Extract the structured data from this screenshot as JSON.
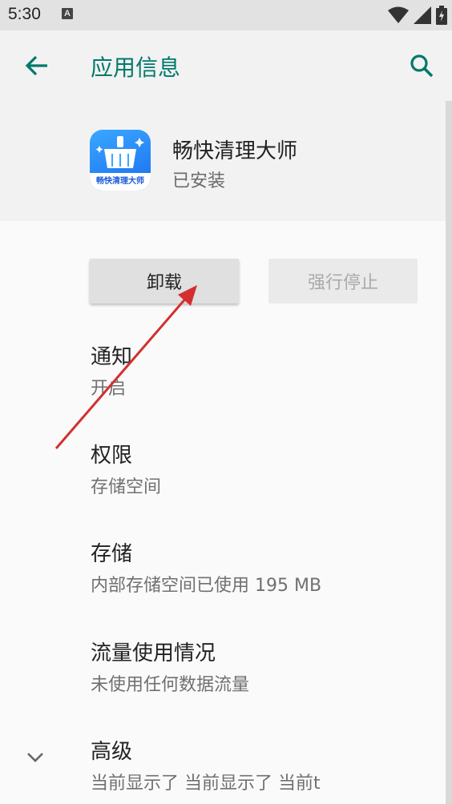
{
  "status_bar": {
    "time": "5:30",
    "notification_icon": "A"
  },
  "app_bar": {
    "title": "应用信息",
    "back_icon": "arrow-back-icon",
    "search_icon": "search-icon"
  },
  "app": {
    "name": "畅快清理大师",
    "status": "已安装",
    "icon_caption": "畅快清理大师",
    "icon_color": "#1a6cf0"
  },
  "buttons": {
    "uninstall": "卸载",
    "force_stop": "强行停止"
  },
  "items": [
    {
      "title": "通知",
      "subtitle": "开启"
    },
    {
      "title": "权限",
      "subtitle": "存储空间"
    },
    {
      "title": "存储",
      "subtitle": "内部存储空间已使用 195 MB"
    },
    {
      "title": "流量使用情况",
      "subtitle": "未使用任何数据流量"
    },
    {
      "title": "高级",
      "subtitle": "当前显示了 当前显示了 当前t"
    }
  ],
  "colors": {
    "accent": "#00796b",
    "annotation_arrow": "#d32f2f"
  }
}
